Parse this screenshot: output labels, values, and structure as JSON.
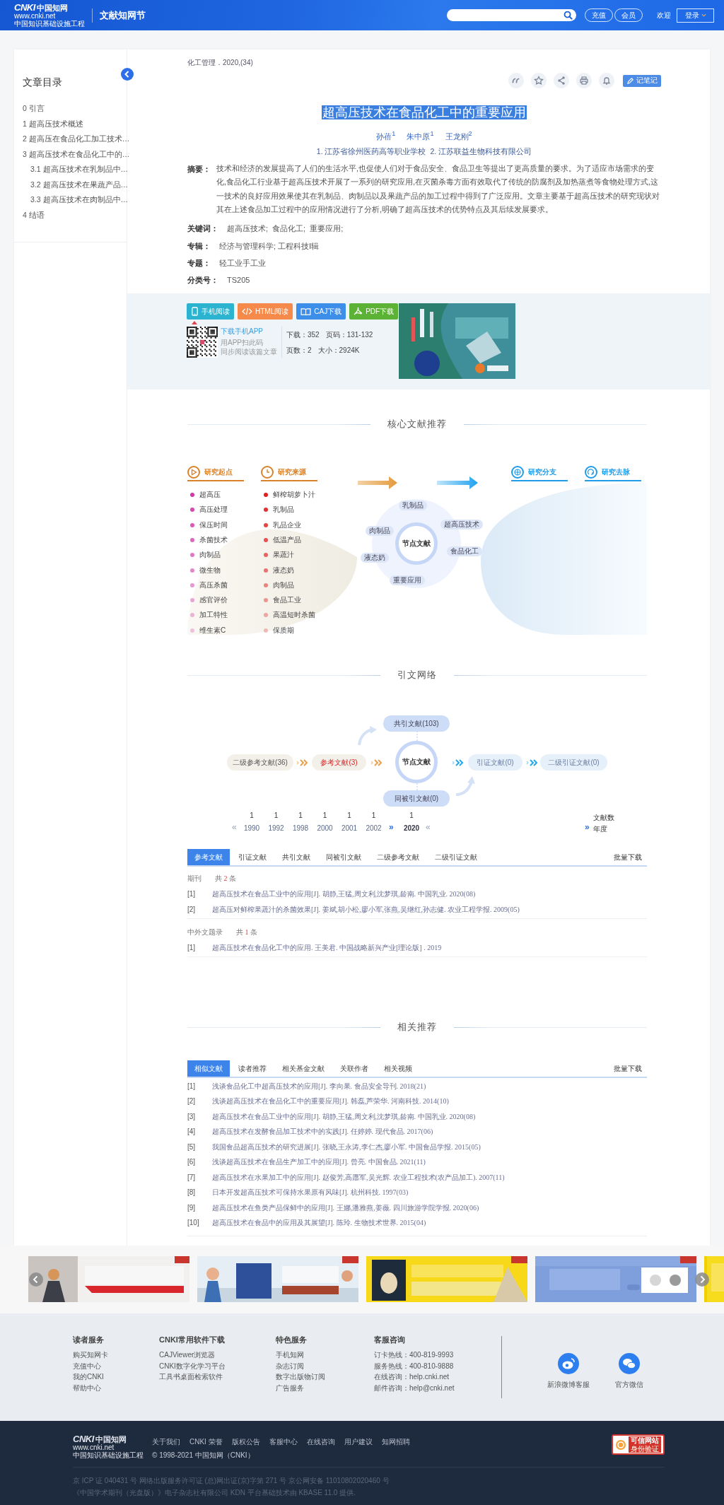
{
  "header": {
    "logo": {
      "brand": "CNKI",
      "chinese": "中国知网",
      "url": "www.cnki.net",
      "tagline": "中国知识基础设施工程"
    },
    "section": "文献知网节",
    "buttons": [
      "充值",
      "会员"
    ],
    "welcome": "欢迎",
    "login": "登录"
  },
  "toc": {
    "title": "文章目录",
    "items": [
      {
        "label": "0 引言"
      },
      {
        "label": "1 超高压技术概述"
      },
      {
        "label": "2 超高压在食品化工加工技术…"
      },
      {
        "label": "3 超高压技术在食品化工中的…",
        "children": [
          {
            "label": "3.1 超高压技术在乳制品中…"
          },
          {
            "label": "3.2 超高压技术在果蔬产品…"
          },
          {
            "label": "3.3 超高压技术在肉制品中…"
          }
        ]
      },
      {
        "label": "4 结语"
      }
    ]
  },
  "article": {
    "source": "化工管理．2020,(34)",
    "note_button": "记笔记",
    "title": "超高压技术在食品化工中的重要应用",
    "title_highlighted": true,
    "authors": [
      "孙蓓$^{1}$",
      "朱中原$^{1}$",
      "王龙刚$^{2}$"
    ],
    "affiliations": [
      "1. 江苏省徐州医药高等职业学校",
      "2. 江苏联益生物科技有限公司"
    ],
    "fields": [
      {
        "label": "摘要：",
        "kind": "paragraph",
        "value": "技术和经济的发展提高了人们的生活水平,也促使人们对于食品安全、食品卫生等提出了更高质量的要求。为了适应市场需求的变化,食品化工行业基于超高压技术开展了一系列的研究应用,在灭菌杀毒方面有效取代了传统的防腐剂及加热蒸煮等食物处理方式,这一技术的良好应用效果使其在乳制品、肉制品以及果蔬产品的加工过程中得到了广泛应用。文章主要基于超高压技术的研究现状对其在上述食品加工过程中的应用情况进行了分析,明确了超高压技术的优势特点及其后续发展要求。"
      },
      {
        "label": "关键词：",
        "kind": "links",
        "values": [
          "超高压技术;",
          "食品化工;",
          "重要应用;"
        ]
      },
      {
        "label": "专辑：",
        "kind": "text",
        "value": "经济与管理科学; 工程科技Ⅰ辑"
      },
      {
        "label": "专题：",
        "kind": "text",
        "value": "轻工业手工业"
      },
      {
        "label": "分类号：",
        "kind": "text",
        "value": "TS205"
      }
    ]
  },
  "download": {
    "buttons": [
      {
        "label": "手机阅读",
        "kind": "mobile",
        "color": "#2bb3cf"
      },
      {
        "label": "HTML阅读",
        "kind": "html",
        "color": "#f58a4b"
      },
      {
        "label": "CAJ下载",
        "kind": "caj",
        "color": "#3d8ee8"
      },
      {
        "label": "PDF下载",
        "kind": "pdf",
        "color": "#5bb234"
      }
    ],
    "app": {
      "link": "下载手机APP",
      "lines": [
        "用APP扫此码",
        "同步阅读该篇文章"
      ]
    },
    "stats": [
      [
        "下载：352",
        "页码：131-132"
      ],
      [
        "页数：2",
        "大小：2924K"
      ]
    ],
    "ad": {
      "kind": "picture"
    }
  },
  "core": {
    "title": "核心文献推荐",
    "node": "节点文献",
    "columns": [
      {
        "label": "研究起点",
        "kind": "start",
        "items": [
          "超高压",
          "高压处理",
          "保压时间",
          "杀菌技术",
          "肉制品",
          "微生物",
          "高压杀菌",
          "感官评价",
          "加工特性",
          "维生素C"
        ]
      },
      {
        "label": "研究来源",
        "kind": "source",
        "items": [
          "鲜榨胡萝卜汁",
          "乳制品",
          "乳品企业",
          "低温产品",
          "果蔬汁",
          "液态奶",
          "肉制品",
          "食品工业",
          "高温短时杀菌",
          "保质期"
        ]
      },
      {
        "label": "研究分支",
        "kind": "branch"
      },
      {
        "label": "研究去脉",
        "kind": "trend"
      }
    ],
    "keywords": [
      "乳制品",
      "超高压技术",
      "食品化工",
      "重要应用",
      "液态奶",
      "肉制品"
    ]
  },
  "network": {
    "title": "引文网络",
    "center": "节点文献",
    "nodes": [
      {
        "label": "二级参考文献(36)",
        "kind": "secondary_reference",
        "selected": false
      },
      {
        "label": "参考文献(3)",
        "kind": "reference",
        "selected": true
      },
      {
        "label": "共引文献(103)",
        "kind": "co_citing",
        "selected": false
      },
      {
        "label": "同被引文献(0)",
        "kind": "co_cited",
        "selected": false
      },
      {
        "label": "引证文献(0)",
        "kind": "citing",
        "selected": false
      },
      {
        "label": "二级引证文献(0)",
        "kind": "secondary_citing",
        "selected": false
      }
    ],
    "timeline": {
      "prev": "«",
      "expand": "»",
      "next": "«",
      "years": [
        {
          "year": "1990",
          "count": "1",
          "selected": false
        },
        {
          "year": "1992",
          "count": "1",
          "selected": false
        },
        {
          "year": "1998",
          "count": "1",
          "selected": false
        },
        {
          "year": "2000",
          "count": "1",
          "selected": false
        },
        {
          "year": "2001",
          "count": "1",
          "selected": false
        },
        {
          "year": "2002",
          "count": "1",
          "selected": false
        },
        {
          "year": "2020",
          "count": "1",
          "selected": true
        }
      ],
      "legend": {
        "count": "文献数",
        "marker": "»",
        "year": "年度"
      }
    },
    "tabs": [
      {
        "label": "参考文献",
        "selected": true
      },
      {
        "label": "引证文献",
        "selected": false
      },
      {
        "label": "共引文献",
        "selected": false
      },
      {
        "label": "同被引文献",
        "selected": false
      },
      {
        "label": "二级参考文献",
        "selected": false
      },
      {
        "label": "二级引证文献",
        "selected": false
      }
    ],
    "action": "批量下载",
    "groups": [
      {
        "label": "期刊",
        "count_before": "共",
        "count": "2",
        "count_after": "条",
        "entries": [
          {
            "index": "[1]",
            "text": "超高压技术在食品工业中的应用[J]. 胡静,王猛,周文利,沈梦琪,龄南. 中国乳业. 2020(08)"
          },
          {
            "index": "[2]",
            "text": "超高压对鲜榨果蔬汁的杀菌效果[J]. 姜斌,胡小松,廖小军,张燕,吴继红,孙志健. 农业工程学报. 2009(05)"
          }
        ]
      },
      {
        "label": "中外文题录",
        "count_before": "共",
        "count": "1",
        "count_after": "条",
        "entries": [
          {
            "index": "[1]",
            "text": "超高压技术在食品化工中的应用. 王美君. 中国战略新兴产业[理论版] . 2019"
          }
        ]
      }
    ]
  },
  "related": {
    "title": "相关推荐",
    "tabs": [
      {
        "label": "相似文献",
        "selected": true
      },
      {
        "label": "读者推荐",
        "selected": false
      },
      {
        "label": "相关基金文献",
        "selected": false
      },
      {
        "label": "关联作者",
        "selected": false
      },
      {
        "label": "相关视频",
        "selected": false
      }
    ],
    "action": "批量下载",
    "entries": [
      {
        "index": "[1]",
        "text": "浅谈食品化工中超高压技术的应用[J]. 李向果. 食品安全导刊. 2018(21)"
      },
      {
        "index": "[2]",
        "text": "浅谈超高压技术在食品化工中的重要应用[J]. 韩磊,芦荣华. 河南科技. 2014(10)"
      },
      {
        "index": "[3]",
        "text": "超高压技术在食品工业中的应用[J]. 胡静,王猛,周文利,沈梦琪,龄南. 中国乳业. 2020(08)"
      },
      {
        "index": "[4]",
        "text": "超高压技术在发酵食品加工技术中的实践[J]. 任婷婷. 现代食品. 2017(06)"
      },
      {
        "index": "[5]",
        "text": "我国食品超高压技术的研究进展[J]. 张晓,王永涛,李仁杰,廖小军. 中国食品学报. 2015(05)"
      },
      {
        "index": "[6]",
        "text": "浅谈超高压技术在食品生产加工中的应用[J]. 曾亮. 中国食品. 2021(11)"
      },
      {
        "index": "[7]",
        "text": "超高压技术在水果加工中的应用[J]. 赵俊芳,高愿军,吴光辉. 农业工程技术(农产品加工). 2007(11)"
      },
      {
        "index": "[8]",
        "text": "日本开发超高压技术可保持水果原有风味[J]. 杭州科技. 1997(03)"
      },
      {
        "index": "[9]",
        "text": "超高压技术在鱼类产品保鲜中的应用[J]. 王娜,潘雅燕,姜薇. 四川旅游学院学报. 2020(06)"
      },
      {
        "index": "[10]",
        "text": "超高压技术在食品中的应用及其展望[J]. 陈玲. 生物技术世界. 2015(04)"
      }
    ]
  },
  "carousel": {
    "slides": [
      {
        "kind": "picture"
      },
      {
        "kind": "picture"
      },
      {
        "kind": "picture"
      },
      {
        "kind": "picture"
      },
      {
        "kind": "picture"
      }
    ]
  },
  "footer": {
    "columns": [
      {
        "title": "读者服务",
        "links": [
          "购买知网卡",
          "充值中心",
          "我的CNKI",
          "帮助中心"
        ]
      },
      {
        "title": "CNKI常用软件下载",
        "links": [
          "CAJViewer浏览器",
          "CNKI数字化学习平台",
          "工具书桌面检索软件"
        ]
      },
      {
        "title": "特色服务",
        "links": [
          "手机知网",
          "杂志订阅",
          "数字出版物订阅",
          "广告服务"
        ]
      },
      {
        "title": "客服咨询",
        "links": [
          "订卡热线：400-819-9993",
          "服务热线：400-810-9888",
          "在线咨询：help.cnki.net",
          "邮件咨询：help@cnki.net"
        ]
      }
    ],
    "social": [
      {
        "label": "新浪微博客服",
        "kind": "weibo"
      },
      {
        "label": "官方微信",
        "kind": "wechat"
      }
    ],
    "bottom": {
      "logo": {
        "brand": "CNKI",
        "chinese": "中国知网",
        "url": "www.cnki.net",
        "tagline": "中国知识基础设施工程"
      },
      "links": [
        "关于我们",
        "CNKI 荣誉",
        "版权公告",
        "客服中心",
        "在线咨询",
        "用户建议",
        "知网招聘"
      ],
      "copyright": "© 1998-2021 中国知网（CNKI）",
      "legal": [
        "京 ICP 证 040431 号 网络出版服务许可证 (总)网出证(京)字第 271 号 京公网安备 11010802020460 号",
        "《中国学术期刊（光盘版）》电子杂志社有限公司 KDN 平台基础技术由 KBASE 11.0 提供."
      ],
      "badge": {
        "title": "可信网站",
        "subtitle": "身份验证"
      }
    }
  }
}
